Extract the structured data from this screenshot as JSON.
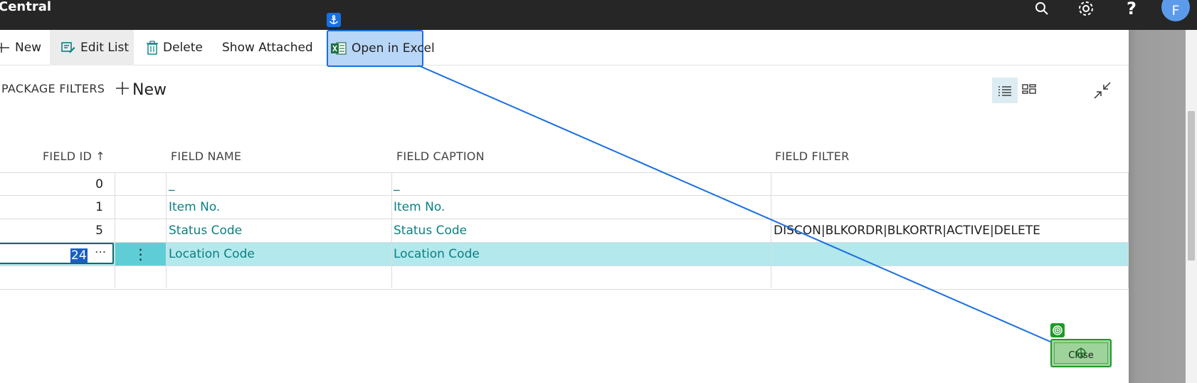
{
  "app": {
    "title": "Central",
    "avatar_initial": "F"
  },
  "topbar_icons": [
    "search-icon",
    "gear-icon",
    "help-icon"
  ],
  "help_glyph": "?",
  "actions": [
    {
      "label": "New",
      "icon": "plus-icon"
    },
    {
      "label": "Edit List",
      "icon": "edit-list-icon"
    },
    {
      "label": "Delete",
      "icon": "trash-icon"
    },
    {
      "label": "Show Attached",
      "icon": ""
    },
    {
      "label": "Open in Excel",
      "icon": "excel-icon"
    }
  ],
  "subpage": {
    "title": "PACKAGE FILTERS",
    "new_label": "New"
  },
  "table": {
    "columns": [
      "FIELD ID",
      "FIELD NAME",
      "FIELD CAPTION",
      "FIELD FILTER"
    ],
    "sort_glyph": "↑",
    "rows": [
      {
        "field_id": "0",
        "field_name": "_",
        "field_caption": "_",
        "field_filter": ""
      },
      {
        "field_id": "1",
        "field_name": "Item No.",
        "field_caption": "Item No.",
        "field_filter": ""
      },
      {
        "field_id": "5",
        "field_name": "Status Code",
        "field_caption": "Status Code",
        "field_filter": "DISCON|BLKORDR|BLKORTR|ACTIVE|DELETE"
      },
      {
        "field_id": "24",
        "field_name": "Location Code",
        "field_caption": "Location Code",
        "field_filter": ""
      }
    ],
    "ellipsis": "···",
    "row_menu_glyph": "⋮"
  },
  "close_label": "Close",
  "colors": {
    "accent_teal": "#0d7f82",
    "selection_row": "#b3e8ec",
    "annotation_blue": "#1a6fe0",
    "annotation_green": "#1e9a28"
  }
}
